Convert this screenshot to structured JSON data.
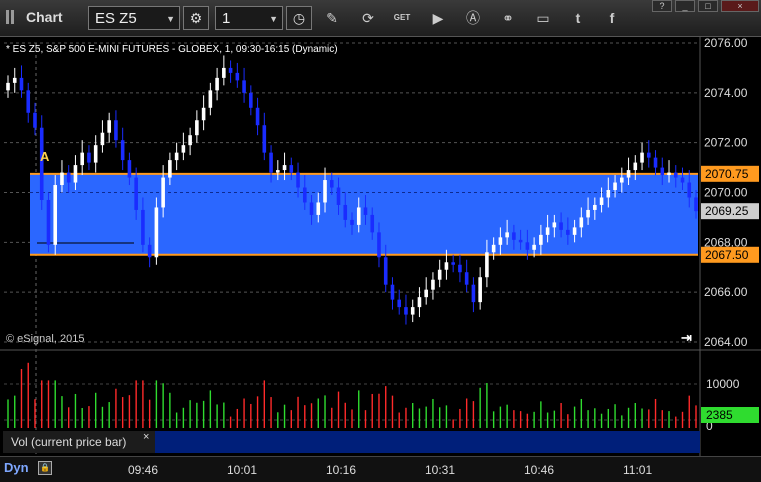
{
  "titlebar": {
    "title": "Chart",
    "symbol": "ES Z5",
    "interval": "1",
    "icons": [
      "settings-gear-icon",
      "clock-icon",
      "pencil-icon",
      "refresh-icon",
      "get-icon",
      "play-icon",
      "alert-icon",
      "link-icon",
      "chat-icon",
      "twitter-icon",
      "facebook-icon"
    ],
    "window_buttons": [
      "?",
      "_",
      "□",
      "×"
    ]
  },
  "chart": {
    "description": "* ES Z5, S&P 500 E-MINI FUTURES - GLOBEX, 1, 09:30-16:15 (Dynamic)",
    "copyright": "© eSignal, 2015",
    "marker_label": "A",
    "colors": {
      "up": "#ffffff",
      "down": "#1a2cff",
      "band": "#2b67ff",
      "level": "#ff9a1f",
      "vol_up": "#2fdc2f",
      "vol_down": "#ff2a2a"
    }
  },
  "chart_data": {
    "type": "candlestick",
    "price_axis": {
      "min": 2064.0,
      "max": 2076.0,
      "ticks": [
        "2076.00",
        "2074.00",
        "2072.00",
        "2070.00",
        "2068.00",
        "2066.00",
        "2064.00"
      ]
    },
    "levels": [
      {
        "label": "2070.75",
        "value": 2070.75
      },
      {
        "label": "2067.50",
        "value": 2067.5
      }
    ],
    "last_price": {
      "label": "2069.25",
      "value": 2069.25
    },
    "closes": [
      2074.4,
      2074.6,
      2074.1,
      2073.2,
      2072.6,
      2069.7,
      2067.9,
      2070.3,
      2070.8,
      2070.4,
      2071.1,
      2071.6,
      2071.2,
      2071.9,
      2072.4,
      2072.9,
      2072.1,
      2071.3,
      2070.6,
      2069.3,
      2067.9,
      2067.4,
      2069.4,
      2070.6,
      2071.3,
      2071.6,
      2071.9,
      2072.3,
      2072.9,
      2073.4,
      2074.1,
      2074.6,
      2075.0,
      2074.8,
      2074.5,
      2074.0,
      2073.4,
      2072.7,
      2071.6,
      2070.8,
      2070.9,
      2071.1,
      2070.8,
      2070.2,
      2069.6,
      2069.1,
      2069.6,
      2070.5,
      2070.2,
      2069.5,
      2068.9,
      2068.7,
      2069.4,
      2069.1,
      2068.4,
      2067.4,
      2066.3,
      2065.7,
      2065.4,
      2065.1,
      2065.4,
      2065.8,
      2066.1,
      2066.5,
      2066.9,
      2067.2,
      2067.1,
      2066.8,
      2066.3,
      2065.6,
      2066.6,
      2067.6,
      2067.9,
      2068.2,
      2068.4,
      2068.1,
      2068.0,
      2067.7,
      2067.9,
      2068.3,
      2068.6,
      2068.8,
      2068.5,
      2068.3,
      2068.6,
      2069.0,
      2069.3,
      2069.5,
      2069.8,
      2070.1,
      2070.4,
      2070.6,
      2070.9,
      2071.2,
      2071.6,
      2071.4,
      2071.0,
      2070.7,
      2070.8,
      2070.6,
      2070.4,
      2069.8,
      2069.25
    ],
    "time_ticks": [
      "09:46",
      "10:01",
      "10:16",
      "10:31",
      "10:46",
      "11:01"
    ],
    "volume_axis": {
      "min": 0,
      "max": 10000,
      "ticks": [
        "10000",
        "0"
      ]
    },
    "last_volume": {
      "label": "2385",
      "value": 2385
    },
    "volume_series_label": "Vol (current price bar)"
  },
  "timeaxis": {
    "mode": "Dyn"
  }
}
